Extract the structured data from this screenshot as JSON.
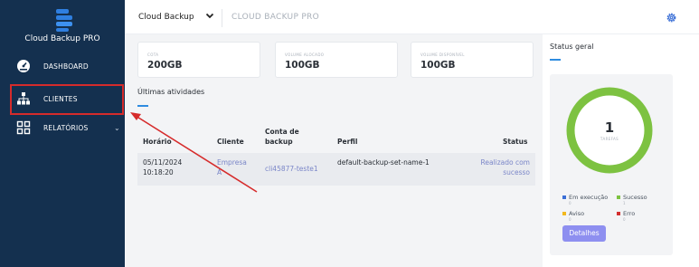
{
  "sidebar": {
    "brand": "Cloud Backup PRO",
    "items": [
      {
        "label": "DASHBOARD",
        "icon": "speedometer-icon"
      },
      {
        "label": "CLIENTES",
        "icon": "sitemap-icon"
      },
      {
        "label": "RELATÓRIOS",
        "icon": "grid-icon"
      }
    ]
  },
  "topbar": {
    "selected": "Cloud Backup",
    "product": "CLOUD BACKUP PRO",
    "settings_icon": "gear-icon"
  },
  "cards": [
    {
      "label": "COTA",
      "value": "200GB"
    },
    {
      "label": "VOLUME ALOCADO",
      "value": "100GB"
    },
    {
      "label": "VOLUME DISPONÍVEL",
      "value": "100GB"
    }
  ],
  "activities": {
    "title": "Últimas atividades",
    "columns": [
      "Horário",
      "Cliente",
      "Conta de backup",
      "Perfil",
      "Status"
    ],
    "rows": [
      {
        "time": "05/11/2024\n10:18:20",
        "client": "Empresa A",
        "account": "cli45877-teste1",
        "profile": "default-backup-set-name-1",
        "status": "Realizado com sucesso"
      }
    ]
  },
  "status_panel": {
    "title": "Status geral",
    "total": "1",
    "total_label": "TAREFAS",
    "legend": [
      {
        "label": "Em execução",
        "count": "0",
        "color": "#3b6fd6"
      },
      {
        "label": "Sucesso",
        "count": "1",
        "color": "#7dc241"
      },
      {
        "label": "Aviso",
        "count": "0",
        "color": "#f2b81d"
      },
      {
        "label": "Erro",
        "count": "0",
        "color": "#d32f2f"
      }
    ],
    "button": "Detalhes",
    "ring_color": "#7dc241"
  },
  "annotation": {
    "color": "#d62b2b"
  }
}
